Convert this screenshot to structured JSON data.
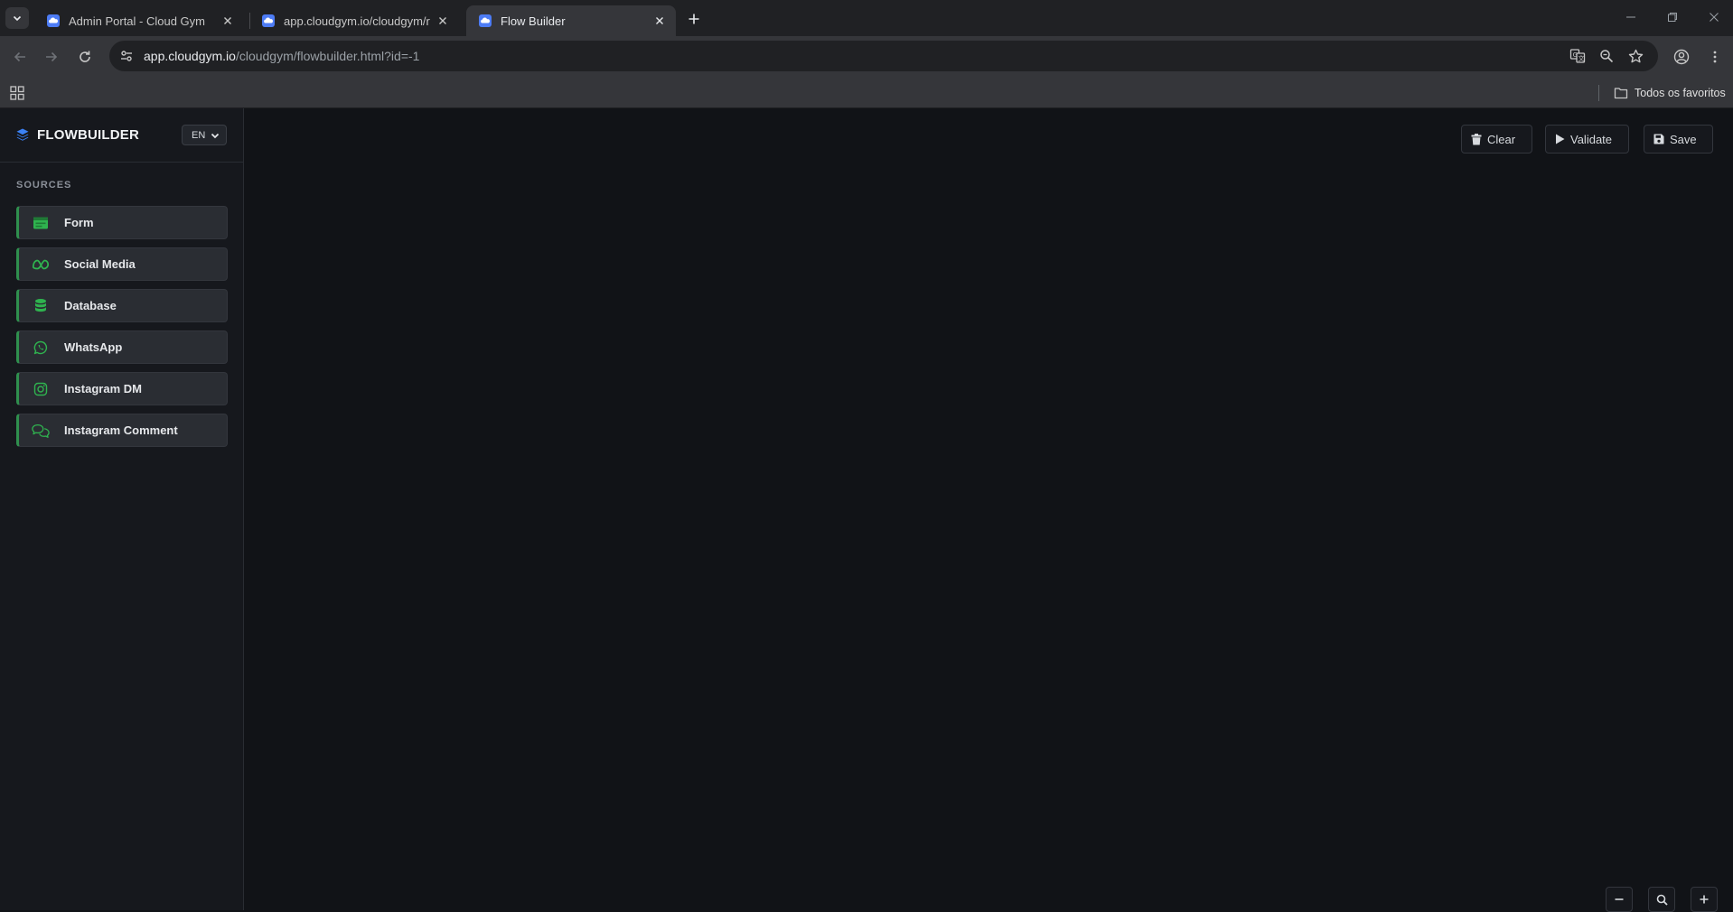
{
  "browser": {
    "tabs": [
      {
        "title": "Admin Portal - Cloud Gym",
        "active": false
      },
      {
        "title": "app.cloudgym.io/cloudgym/rep",
        "active": false
      },
      {
        "title": "Flow Builder",
        "active": true
      }
    ],
    "url_host": "app.cloudgym.io",
    "url_path": "/cloudgym/flowbuilder.html?id=-1",
    "bookmarks_folder": "Todos os favoritos"
  },
  "app": {
    "brand": "FLOWBUILDER",
    "language": "EN",
    "sources_title": "SOURCES",
    "sources": [
      {
        "label": "Form",
        "icon": "form-icon"
      },
      {
        "label": "Social Media",
        "icon": "meta-icon"
      },
      {
        "label": "Database",
        "icon": "database-icon"
      },
      {
        "label": "WhatsApp",
        "icon": "whatsapp-icon"
      },
      {
        "label": "Instagram DM",
        "icon": "instagram-icon"
      },
      {
        "label": "Instagram Comment",
        "icon": "comments-icon"
      }
    ],
    "toolbar": {
      "clear": "Clear",
      "validate": "Validate",
      "save": "Save"
    }
  },
  "colors": {
    "accent_green": "#2fb34f",
    "brand_blue": "#3b82f6",
    "background": "#111317"
  }
}
